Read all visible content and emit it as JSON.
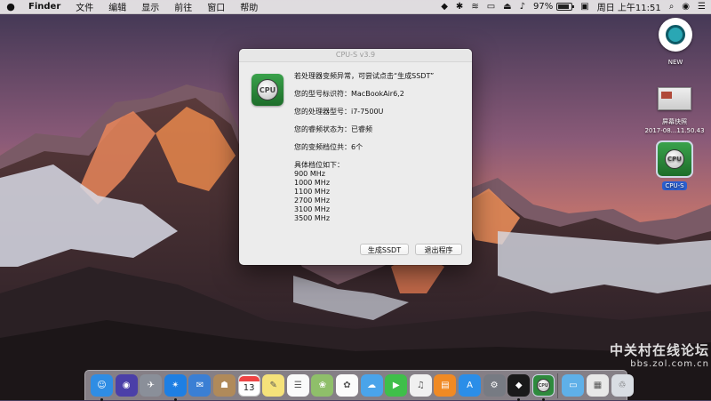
{
  "menubar": {
    "finder": "Finder",
    "items": [
      "文件",
      "编辑",
      "显示",
      "前往",
      "窗口",
      "帮助"
    ],
    "battery_percent": "97%",
    "datetime": "周日 上午11:51"
  },
  "dialog": {
    "title": "CPU-S v3.9",
    "icon_label": "CPU",
    "lines": [
      "若处理器变频异常，可尝试点击“生成SSDT”",
      "您的型号标识符：MacBookAir6,2",
      "您的处理器型号：i7-7500U",
      "您的睿频状态为：已睿频",
      "您的变频档位共：6个"
    ],
    "levels_header": "具体档位如下：",
    "levels": [
      "900 MHz",
      "1000 MHz",
      "1100 MHz",
      "2700 MHz",
      "3100 MHz",
      "3500 MHz"
    ],
    "buttons": {
      "generate": "生成SSDT",
      "quit": "退出程序"
    }
  },
  "desktop": {
    "new_label": "NEW",
    "screenshot_label_1": "屏幕快照",
    "screenshot_label_2": "2017-08...11.50.43",
    "cpus_icon_text": "CPU",
    "cpus_label": "CPU-S"
  },
  "dock": {
    "calendar_day": "13",
    "cpus_text": "CPU",
    "items": [
      {
        "name": "finder",
        "color": "#2f8de4",
        "glyph": "☺"
      },
      {
        "name": "siri",
        "color": "#4b3fa8",
        "glyph": "◉"
      },
      {
        "name": "launchpad",
        "color": "#8a8f99",
        "glyph": "✈"
      },
      {
        "name": "safari",
        "color": "#1e7fe3",
        "glyph": "✴"
      },
      {
        "name": "mail",
        "color": "#3b7fd4",
        "glyph": "✉"
      },
      {
        "name": "contacts",
        "color": "#b08a5a",
        "glyph": "☗"
      },
      {
        "name": "calendar",
        "color": "#ffffff",
        "glyph": ""
      },
      {
        "name": "notes",
        "color": "#f5e27a",
        "glyph": "✎"
      },
      {
        "name": "reminders",
        "color": "#fafafa",
        "glyph": "☰"
      },
      {
        "name": "preview",
        "color": "#8fbf6a",
        "glyph": "❀"
      },
      {
        "name": "photos",
        "color": "#fbfbfb",
        "glyph": "✿"
      },
      {
        "name": "messages-bubble",
        "color": "#4aa4ea",
        "glyph": "☁"
      },
      {
        "name": "facetime",
        "color": "#3fbf4a",
        "glyph": "▶"
      },
      {
        "name": "itunes",
        "color": "#f0f0f0",
        "glyph": "♫"
      },
      {
        "name": "ibooks",
        "color": "#f08a24",
        "glyph": "▤"
      },
      {
        "name": "app-store",
        "color": "#2b8ee8",
        "glyph": "A"
      },
      {
        "name": "system-preferences",
        "color": "#777b83",
        "glyph": "⚙"
      },
      {
        "name": "qq",
        "color": "#1a1a1a",
        "glyph": "◆"
      },
      {
        "name": "cpu-s",
        "color": "#2e8a3d",
        "glyph": ""
      },
      {
        "name": "folder",
        "color": "#5fb0e8",
        "glyph": "▭"
      },
      {
        "name": "clipboard",
        "color": "#e8e8e8",
        "glyph": "▦"
      },
      {
        "name": "trash",
        "color": "#d9dde3",
        "glyph": "♲"
      }
    ]
  },
  "watermark": {
    "line1": "中关村在线论坛",
    "line2": "bbs.zol.com.cn"
  }
}
